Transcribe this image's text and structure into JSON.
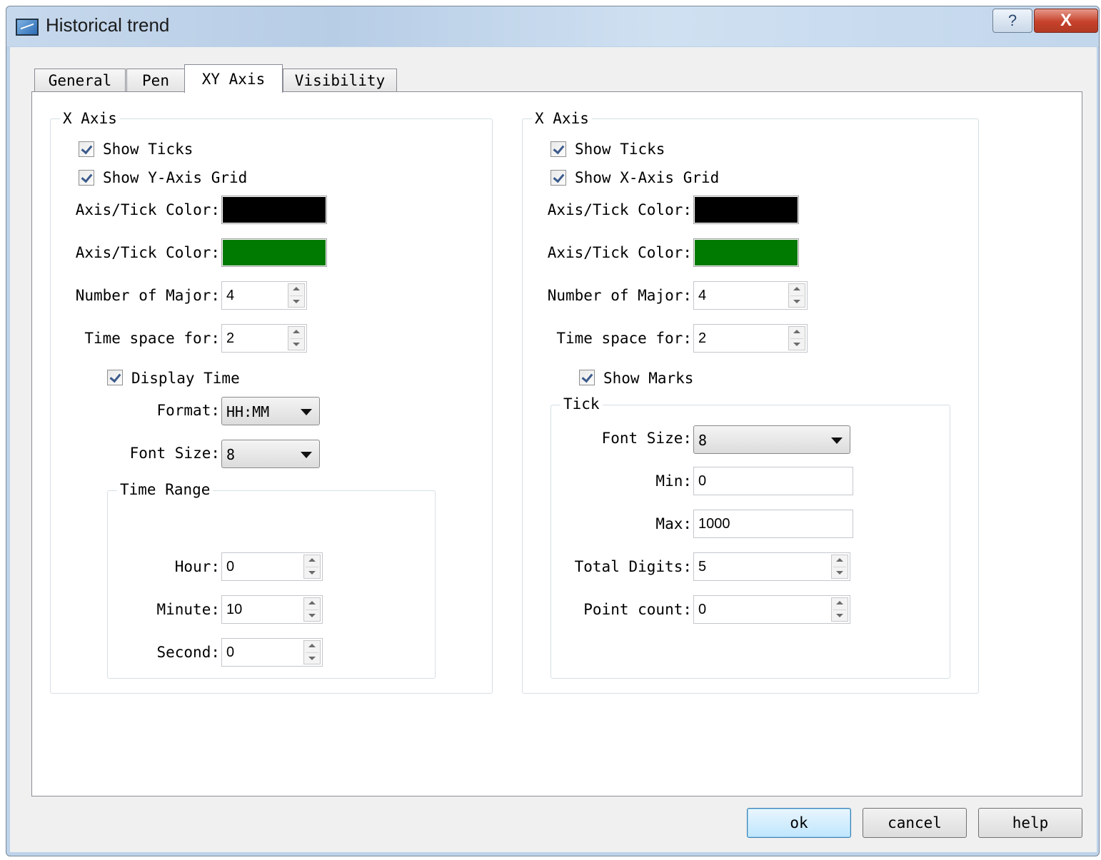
{
  "window": {
    "title": "Historical trend",
    "help_label": "?",
    "close_label": "X"
  },
  "tabs": [
    {
      "label": "General"
    },
    {
      "label": "Pen"
    },
    {
      "label": "XY Axis"
    },
    {
      "label": "Visibility"
    }
  ],
  "active_tab": "XY Axis",
  "left": {
    "group_title": "X Axis",
    "show_ticks": {
      "label": "Show Ticks",
      "checked": true
    },
    "show_grid": {
      "label": "Show Y-Axis Grid",
      "checked": true
    },
    "axis_color_label": "Axis/Tick Color:",
    "axis_color": "#000000",
    "grid_color_label": "Axis/Tick Color:",
    "grid_color": "#007a00",
    "major_label": "Number of Major:",
    "major_value": "4",
    "timespace_label": "Time space for:",
    "timespace_value": "2",
    "display_time": {
      "label": "Display Time",
      "checked": true
    },
    "format_label": "Format:",
    "format_value": "HH:MM",
    "fontsize_label": "Font Size:",
    "fontsize_value": "8",
    "time_range": {
      "title": "Time Range",
      "hour_label": "Hour:",
      "hour_value": "0",
      "minute_label": "Minute:",
      "minute_value": "10",
      "second_label": "Second:",
      "second_value": "0"
    }
  },
  "right": {
    "group_title": "X Axis",
    "show_ticks": {
      "label": "Show Ticks",
      "checked": true
    },
    "show_grid": {
      "label": "Show X-Axis Grid",
      "checked": true
    },
    "axis_color_label": "Axis/Tick Color:",
    "axis_color": "#000000",
    "grid_color_label": "Axis/Tick Color:",
    "grid_color": "#007a00",
    "major_label": "Number of Major:",
    "major_value": "4",
    "timespace_label": "Time space for:",
    "timespace_value": "2",
    "show_marks": {
      "label": "Show Marks",
      "checked": true
    },
    "tick": {
      "title": "Tick",
      "fontsize_label": "Font Size:",
      "fontsize_value": "8",
      "min_label": "Min:",
      "min_value": "0",
      "max_label": "Max:",
      "max_value": "1000",
      "digits_label": "Total Digits:",
      "digits_value": "5",
      "count_label": "Point count:",
      "count_value": "0"
    }
  },
  "buttons": {
    "ok": "ok",
    "cancel": "cancel",
    "help": "help"
  }
}
